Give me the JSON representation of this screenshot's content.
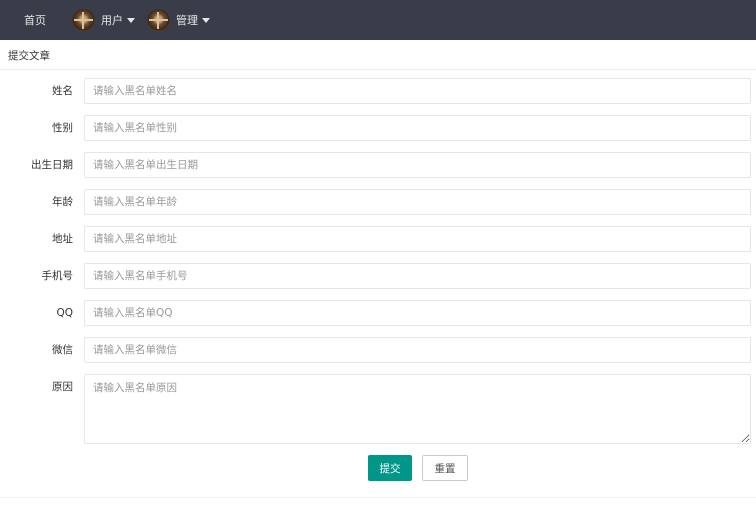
{
  "nav": {
    "home": "首页",
    "user": "用户",
    "admin": "管理"
  },
  "card": {
    "title": "提交文章"
  },
  "form": {
    "fields": [
      {
        "label": "姓名",
        "placeholder": "请输入黑名单姓名"
      },
      {
        "label": "性别",
        "placeholder": "请输入黑名单性别"
      },
      {
        "label": "出生日期",
        "placeholder": "请输入黑名单出生日期"
      },
      {
        "label": "年龄",
        "placeholder": "请输入黑名单年龄"
      },
      {
        "label": "地址",
        "placeholder": "请输入黑名单地址"
      },
      {
        "label": "手机号",
        "placeholder": "请输入黑名单手机号"
      },
      {
        "label": "QQ",
        "placeholder": "请输入黑名单QQ"
      },
      {
        "label": "微信",
        "placeholder": "请输入黑名单微信"
      }
    ],
    "reason": {
      "label": "原因",
      "placeholder": "请输入黑名单原因"
    },
    "submit_label": "提交",
    "reset_label": "重置"
  },
  "colors": {
    "nav_bg": "#393d49",
    "primary": "#009688"
  }
}
